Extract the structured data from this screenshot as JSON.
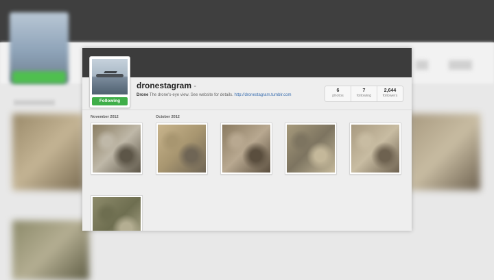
{
  "profile": {
    "username": "dronestagram",
    "name": "Drone",
    "bio": " The drone's-eye view. See website for details. ",
    "website": "http://dronestagram.tumblr.com",
    "follow_label": "Following",
    "stats": [
      {
        "value": "6",
        "label": "photos"
      },
      {
        "value": "7",
        "label": "following"
      },
      {
        "value": "2,644",
        "label": "followers"
      }
    ]
  },
  "photos": {
    "months": [
      "November 2012",
      "October 2012"
    ],
    "items": [
      {
        "month": "November 2012",
        "palette": [
          "#8a7d62",
          "#bfb8a8",
          "#5d5648"
        ]
      },
      {
        "month": "October 2012",
        "palette": [
          "#c8b48c",
          "#a89670",
          "#6f6555"
        ]
      },
      {
        "month": "October 2012",
        "palette": [
          "#8a7a60",
          "#b8a890",
          "#5a4e3e"
        ]
      },
      {
        "month": "October 2012",
        "palette": [
          "#a69a7c",
          "#7d7460",
          "#c4b89a"
        ]
      },
      {
        "month": "October 2012",
        "palette": [
          "#a89a80",
          "#c8bca2",
          "#6e6250"
        ]
      },
      {
        "month": "October 2012",
        "palette": [
          "#8c8a6a",
          "#6e6e50",
          "#b4ae92"
        ]
      }
    ]
  },
  "colors": {
    "accent_follow": "#3fae49",
    "link": "#3b6fb0",
    "topbar": "#3c3c3c"
  }
}
